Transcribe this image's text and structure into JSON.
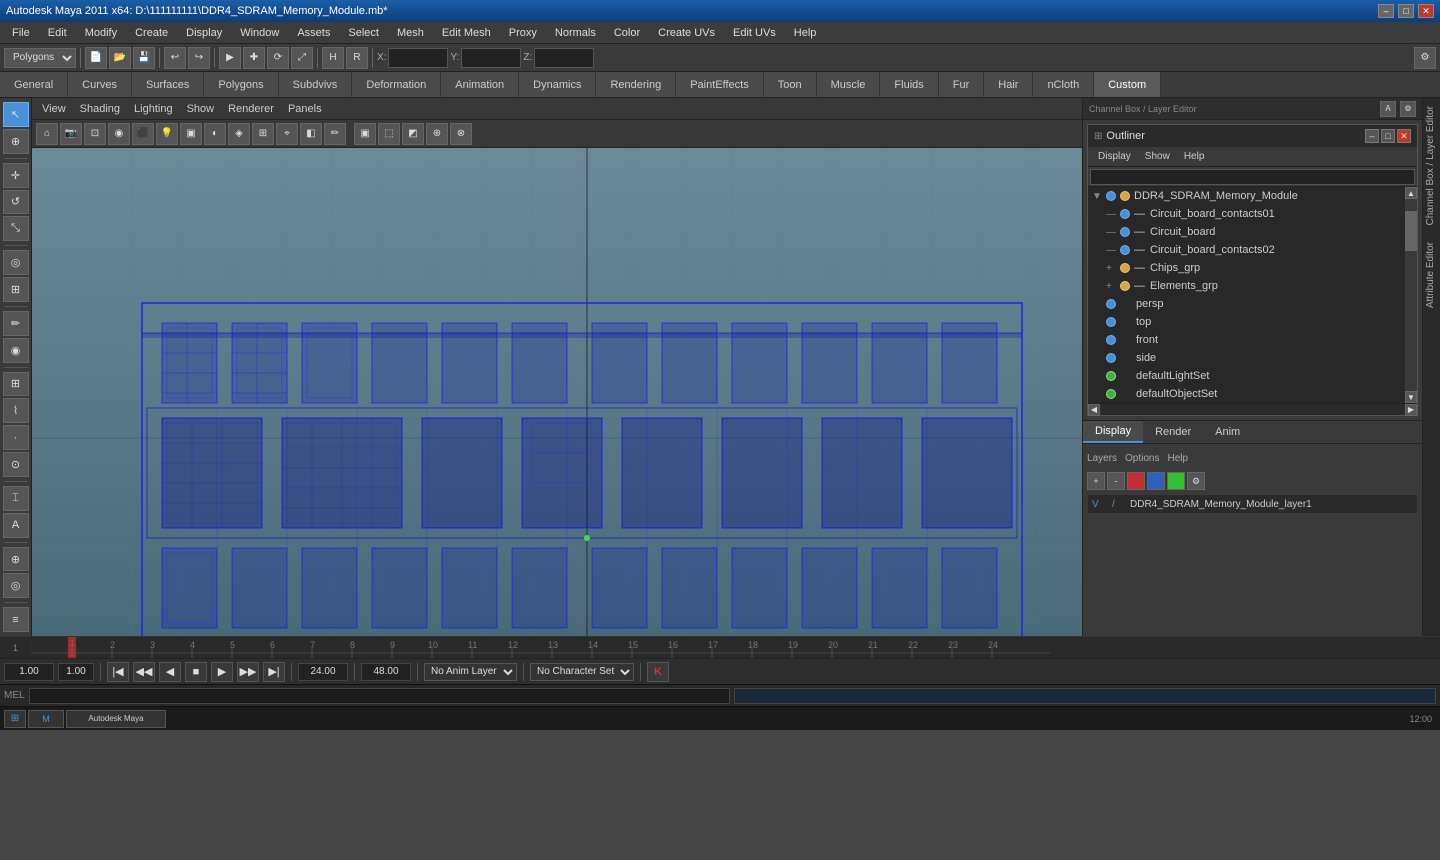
{
  "titlebar": {
    "title": "Autodesk Maya 2011 x64: D:\\111111111\\DDR4_SDRAM_Memory_Module.mb*",
    "minimize": "–",
    "maximize": "□",
    "close": "✕"
  },
  "menubar": {
    "items": [
      "File",
      "Edit",
      "Modify",
      "Create",
      "Display",
      "Window",
      "Assets",
      "Select",
      "Mesh",
      "Edit Mesh",
      "Proxy",
      "Normals",
      "Color",
      "Create UVs",
      "Edit UVs",
      "Help"
    ]
  },
  "toolbar1": {
    "mode_select": "Polygons",
    "xyz_label": "Z:"
  },
  "module_tabs": {
    "items": [
      "General",
      "Curves",
      "Surfaces",
      "Polygons",
      "Subdvivs",
      "Deformation",
      "Animation",
      "Dynamics",
      "Rendering",
      "PaintEffects",
      "Toon",
      "Muscle",
      "Fluids",
      "Fur",
      "Hair",
      "nCloth",
      "Custom"
    ]
  },
  "viewport": {
    "menus": [
      "View",
      "Shading",
      "Lighting",
      "Show",
      "Renderer",
      "Panels"
    ]
  },
  "outliner": {
    "title": "Outliner",
    "menus": [
      "Display",
      "Show",
      "Help"
    ],
    "tree": [
      {
        "id": "ddr4",
        "label": "DDR4_SDRAM_Memory_Module",
        "indent": 0,
        "expanded": true,
        "icon": "blue"
      },
      {
        "id": "cc01",
        "label": "Circuit_board_contacts01",
        "indent": 1,
        "icon": "blue"
      },
      {
        "id": "cb",
        "label": "Circuit_board",
        "indent": 1,
        "icon": "blue"
      },
      {
        "id": "cc02",
        "label": "Circuit_board_contacts02",
        "indent": 1,
        "icon": "blue"
      },
      {
        "id": "chips",
        "label": "Chips_grp",
        "indent": 1,
        "icon": "yellow",
        "expandable": true
      },
      {
        "id": "elements",
        "label": "Elements_grp",
        "indent": 1,
        "icon": "yellow",
        "expandable": true
      },
      {
        "id": "persp",
        "label": "persp",
        "indent": 0,
        "icon": "blue"
      },
      {
        "id": "top",
        "label": "top",
        "indent": 0,
        "icon": "blue"
      },
      {
        "id": "front",
        "label": "front",
        "indent": 0,
        "icon": "blue"
      },
      {
        "id": "side",
        "label": "side",
        "indent": 0,
        "icon": "blue"
      },
      {
        "id": "dls",
        "label": "defaultLightSet",
        "indent": 0,
        "icon": "green"
      },
      {
        "id": "dos",
        "label": "defaultObjectSet",
        "indent": 0,
        "icon": "green"
      }
    ]
  },
  "channel_tabs": {
    "items": [
      "Display",
      "Render",
      "Anim"
    ],
    "active": "Display"
  },
  "layers": {
    "header_items": [
      "Layers",
      "Options",
      "Help"
    ],
    "layer": {
      "v": "V",
      "name": "DDR4_SDRAM_Memory_Module_layer1"
    }
  },
  "timeline": {
    "ticks": [
      1,
      2,
      3,
      4,
      5,
      6,
      7,
      8,
      9,
      10,
      11,
      12,
      13,
      14,
      15,
      16,
      17,
      18,
      19,
      20,
      21,
      22,
      23,
      24
    ],
    "current_frame": "1"
  },
  "transport": {
    "start_frame": "1.00",
    "end_frame": "24.00",
    "range_end": "48.00",
    "current": "1.00",
    "anim_layer": "No Anim Layer",
    "char_set": "No Character Set"
  },
  "mel": {
    "label": "MEL"
  },
  "taskbar": {
    "maya_icon": "M",
    "window1": "─",
    "window2": "×"
  }
}
